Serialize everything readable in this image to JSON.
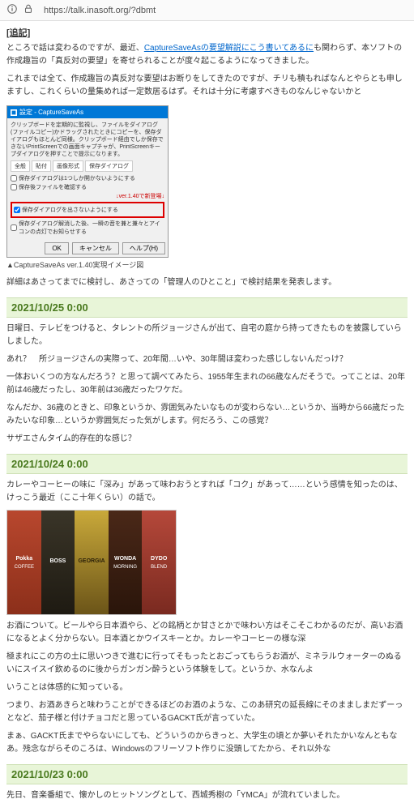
{
  "browser": {
    "url": "https://talk.inasoft.org/?dbmt"
  },
  "tsuiki_label": "[追記]",
  "intro1": "ところで話は変わるのですが、最近、",
  "intro_link": "CaptureSaveAsの要望解説にこう書いてあるに",
  "intro2": "も関わらず、本ソフトの作成趣旨の「真反対の要望」を寄せられることが度々起こるようになってきました。",
  "intro3": "これまでは全て、作成趣旨の真反対な要望はお断りをしてきたのですが、チリも積もればなんとやらとも申しますし、これくらいの量集めれば一定数居るはず。それは十分に考慮すべきものなんじゃないかと",
  "dialog": {
    "title": "設定 - CaptureSaveAs",
    "desc": "クリップボードを定期的に監視し、ファイルをダイアログ(ファイルコピー)かドラッグされたときにコピーを、保存ダイアログもほとんど同様。クリップボード経由でしか保存できないPrintScreenでの画面キャプチャが、PrintScreenキープダイアログを押すことで提示になります。",
    "tab1": "全般",
    "tab2": "貼付",
    "tab3": "画像形式",
    "tab4": "保存ダイアログ",
    "cb1": "保存ダイアログは1つしか開かないようにする",
    "cb2": "保存後ファイルを確認する",
    "ver_note": "↓ver.1.40で新登場↓",
    "cb3": "保存ダイアログを出さないようにする",
    "cb4": "保存ダイアログ解消した後、一瞬の音を兼と兼々とアイコンの点灯でお知らせする",
    "btn_ok": "OK",
    "btn_cancel": "キャンセル",
    "btn_help": "ヘルプ(H)"
  },
  "dialog_caption": "▲CaptureSaveAs ver.1.40実現イメージ図",
  "closing": "詳細はあさってまでに検討し、あさっての「管理人のひとこと」で検討結果を発表します。",
  "entries": [
    {
      "date": "2021/10/25 0:00",
      "paras": [
        "日曜日、テレビをつけると、タレントの所ジョージさんが出て、自宅の庭から持ってきたものを披露していらしました。",
        "あれ？　所ジョージさんの実際って、20年間…いや、30年間ほ変わった感じしないんだっけ？",
        "一体おいくつの方なんだろう？と思って調べてみたら、1955年生まれの66歳なんだそうで。ってことは、20年前は46歳だったし、30年前は36歳だったワケだ。",
        "なんだか、36歳のときと、印象というか、雰囲気みたいなものが変わらない…というか、当時から66歳だったみたいな印象…というか雰囲気だった気がします。何だろう、この感覚？",
        "サザエさんタイム的存在的な感じ？"
      ]
    },
    {
      "date": "2021/10/24 0:00",
      "paras_before_img": [
        "カレーやコーヒーの味に「深み」があって味わおうとすれば「コク」があって……という感情を知ったのは、けっこう最近（ここ十年くらい）の話で。"
      ],
      "has_cans_image": true,
      "paras_after_img": [
        "お酒について。ビールやら日本酒やら、どの銘柄とか甘さとかで味わい方はそこそこわかるのだが、高いお酒になるとよく分からない。日本酒とかウイスキーとか。カレーやコーヒーの様な深",
        "極まれにこの方の土に思いつきで進むに行ってそもったとおごってもらうお酒が、ミネラルウォーターのぬるいにスイスイ飲めるのに後からガンガン酔うという体験をして。というか、水なんよ",
        "いうことは体感的に知っている。",
        "つまり、お酒あきらと味わうことができるほどのお酒のような、このあ研究の延長線にそのまましまだずーっとなど、茄子様と付けチョコだと思っているGACKT氏が言っていた。",
        "まぁ、GACKT氏までやらないにしても、どういうのからきっと、大学生の頃とか夢いそれたかいなんともなあ。残念ながらそのころは、Windowsのフリーソフト作りに没頭してたから、それ以外な"
      ]
    },
    {
      "date": "2021/10/23 0:00",
      "paras": [
        "先日、音楽番組で、懐かしのヒットソングとして、西城秀樹の「YMCA」が流れていました。"
      ]
    }
  ],
  "cans": [
    {
      "brand": "Pokka",
      "sub": "COFFEE"
    },
    {
      "brand": "BOSS",
      "sub": ""
    },
    {
      "brand": "GEORGIA",
      "sub": ""
    },
    {
      "brand": "WONDA",
      "sub": "MORNING"
    },
    {
      "brand": "DYDO",
      "sub": "BLEND"
    }
  ]
}
